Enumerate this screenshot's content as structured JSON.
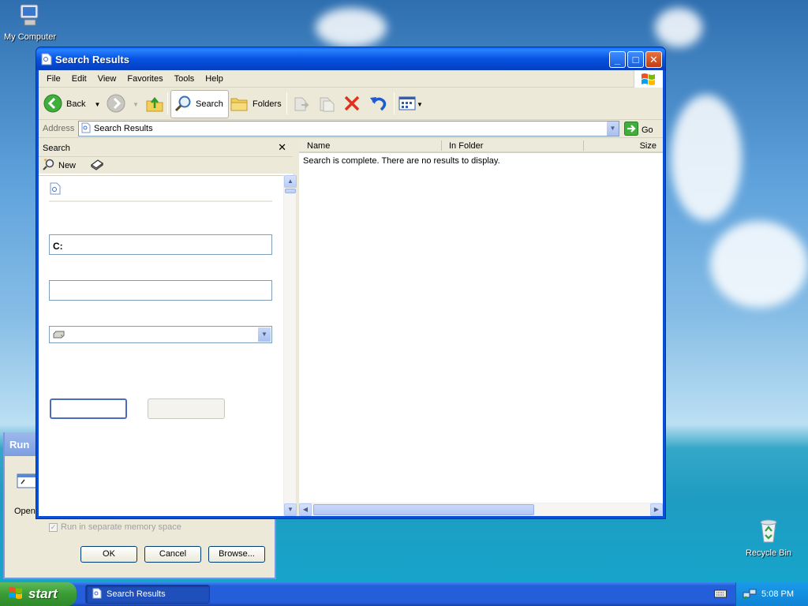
{
  "desktop": {
    "icons": {
      "my_computer": "My Computer",
      "recycle_bin": "Recycle Bin"
    }
  },
  "run_dialog": {
    "title": "Run",
    "open_label": "Open",
    "checkbox_label": "Run in separate memory space",
    "ok_label": "OK",
    "cancel_label": "Cancel",
    "browse_label": "Browse..."
  },
  "window": {
    "title": "Search Results",
    "menu": [
      "File",
      "Edit",
      "View",
      "Favorites",
      "Tools",
      "Help"
    ],
    "toolbar": {
      "back_label": "Back",
      "search_label": "Search",
      "folders_label": "Folders"
    },
    "address": {
      "label": "Address",
      "value": "Search Results",
      "go_label": "Go"
    },
    "search_pane": {
      "title": "Search",
      "new_label": "New",
      "lookin_value": "C:"
    },
    "results": {
      "columns": [
        "Name",
        "In Folder",
        "Size"
      ],
      "empty_message": "Search is complete. There are no results to display."
    }
  },
  "taskbar": {
    "start_label": "start",
    "task_label": "Search Results",
    "clock": "5:08 PM"
  },
  "colors": {
    "titlebar": "#0653e0",
    "taskbar": "#245edb",
    "start_button": "#3a9b35",
    "tray": "#0f83d6",
    "window_face": "#ece9d8"
  }
}
